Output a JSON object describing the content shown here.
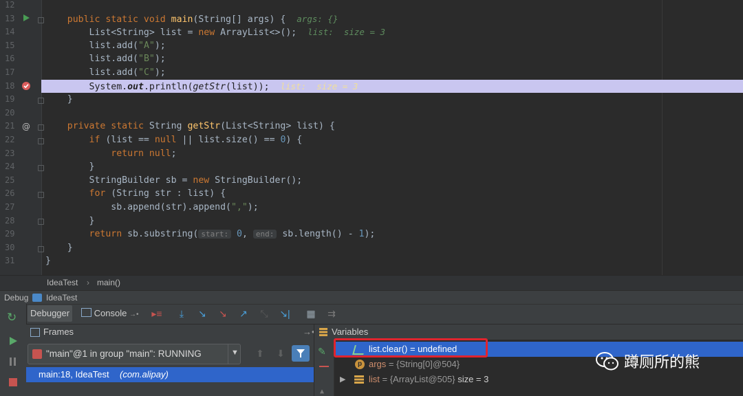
{
  "editor": {
    "line_numbers": [
      "12",
      "13",
      "14",
      "15",
      "16",
      "17",
      "18",
      "19",
      "20",
      "21",
      "22",
      "23",
      "24",
      "25",
      "26",
      "27",
      "28",
      "29",
      "30",
      "31"
    ],
    "lines": {
      "l13": {
        "kw": "public static void ",
        "fn": "main",
        "rest": "(String[] args) {",
        "hint": "args: {}"
      },
      "l14": {
        "a": "List<String> list = ",
        "kw": "new ",
        "b": "ArrayList<>();",
        "hint": "list:  size = 3"
      },
      "l15": {
        "a": "list.add(",
        "s": "\"A\"",
        "b": ");"
      },
      "l16": {
        "a": "list.add(",
        "s": "\"B\"",
        "b": ");"
      },
      "l17": {
        "a": "list.add(",
        "s": "\"C\"",
        "b": ");"
      },
      "l18": {
        "a": "System.",
        "out": "out",
        "b": ".println(",
        "c": "getStr",
        "d": "(list));",
        "hint": "list:  size = 3"
      },
      "l19": "}",
      "l21": {
        "kw": "private static ",
        "a": "String ",
        "fn": "getStr",
        "rest": "(List<String> list) {"
      },
      "l22": {
        "kw": "if ",
        "a": "(list == ",
        "kw2": "null",
        "b": " || list.size() == ",
        "n": "0",
        "c": ") {"
      },
      "l23": {
        "kw": "return null",
        "a": ";"
      },
      "l24": "}",
      "l25": {
        "a": "StringBuilder sb = ",
        "kw": "new ",
        "b": "StringBuilder();"
      },
      "l26": {
        "kw": "for ",
        "a": "(String str : list) {"
      },
      "l27": {
        "a": "sb.append(str).append(",
        "s": "\",\"",
        "b": ");"
      },
      "l28": "}",
      "l29": {
        "kw": "return ",
        "a": "sb.substring(",
        "p1": "start:",
        "n1": "0",
        "b": ", ",
        "p2": "end:",
        "c": "sb.length() - ",
        "n2": "1",
        "d": ");"
      },
      "l30": "}",
      "l31": "}"
    }
  },
  "breadcrumb": {
    "a": "IdeaTest",
    "b": "main()"
  },
  "debug": {
    "title_label": "Debug",
    "config_name": "IdeaTest",
    "tab_debugger": "Debugger",
    "tab_console": "Console",
    "frames_label": "Frames",
    "thread_value": "\"main\"@1 in group \"main\": RUNNING",
    "frame_row": "main:18, IdeaTest",
    "frame_pkg": "(com.alipay)",
    "variables_label": "Variables",
    "watch": {
      "expr": "list.clear()",
      "eq": " = ",
      "val": "undefined"
    },
    "vars": [
      {
        "name": "args",
        "val": " = {String[0]@504}"
      },
      {
        "name": "list",
        "val": " = {ArrayList@505}",
        "extra": "  size = 3"
      }
    ]
  },
  "watermark": "蹲厕所的熊",
  "colors": {
    "highlight_line": "#c9c6f0",
    "selection": "#2f65ca",
    "red_box": "#e0242e"
  }
}
